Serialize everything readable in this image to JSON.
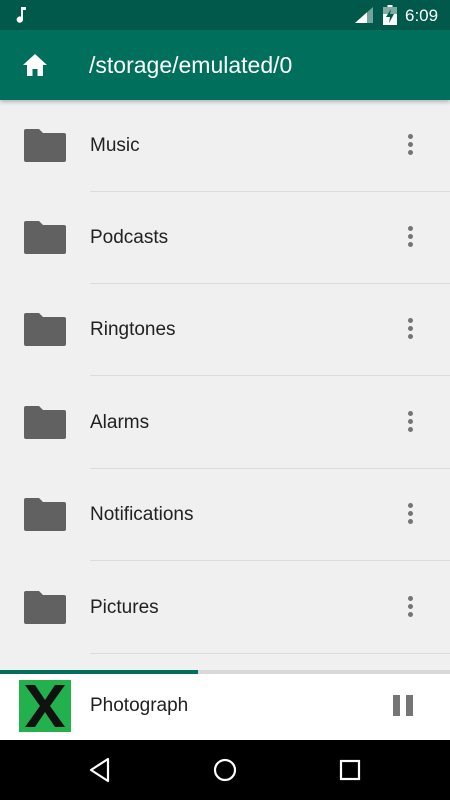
{
  "status_bar": {
    "time": "6:09",
    "icons": [
      "music-note-icon",
      "cell-signal-icon",
      "battery-charging-icon"
    ]
  },
  "app_bar": {
    "home_icon": "home-icon",
    "path": "/storage/emulated/0"
  },
  "folders": [
    {
      "name": "Music",
      "icon": "folder-icon",
      "menu_icon": "more-vert-icon"
    },
    {
      "name": "Podcasts",
      "icon": "folder-icon",
      "menu_icon": "more-vert-icon"
    },
    {
      "name": "Ringtones",
      "icon": "folder-icon",
      "menu_icon": "more-vert-icon"
    },
    {
      "name": "Alarms",
      "icon": "folder-icon",
      "menu_icon": "more-vert-icon"
    },
    {
      "name": "Notifications",
      "icon": "folder-icon",
      "menu_icon": "more-vert-icon"
    },
    {
      "name": "Pictures",
      "icon": "folder-icon",
      "menu_icon": "more-vert-icon"
    }
  ],
  "player": {
    "track_title": "Photograph",
    "progress": 0.44,
    "pause_icon": "pause-icon",
    "art_icon": "album-art-x"
  },
  "nav_bar": {
    "buttons": [
      "back-icon",
      "home-circle-icon",
      "recents-icon"
    ]
  },
  "colors": {
    "status_bar": "#00594a",
    "app_bar": "#00705c",
    "background": "#f0f0f0",
    "folder": "#616161",
    "accent": "#00705c",
    "album_art": "#22b14c"
  }
}
